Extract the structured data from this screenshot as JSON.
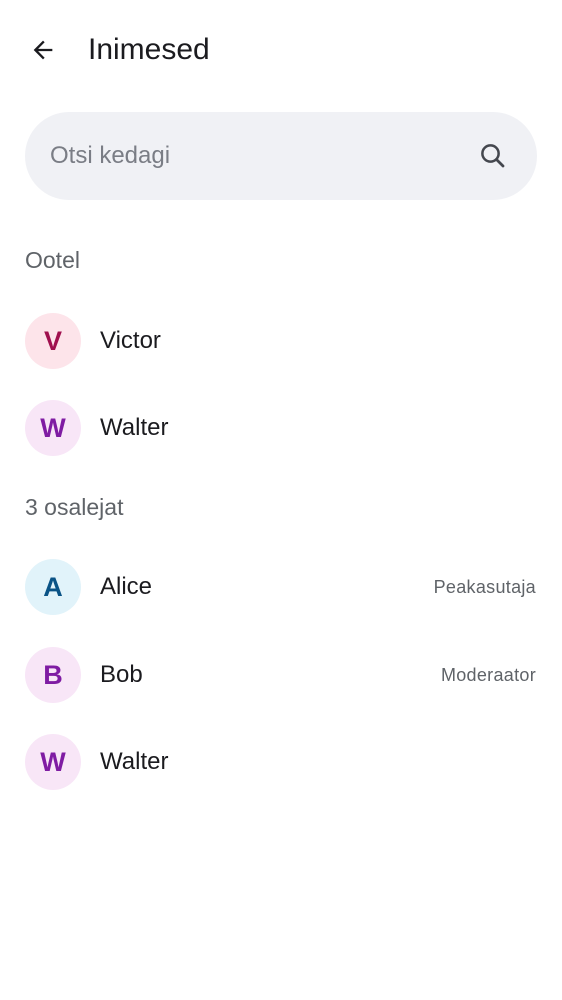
{
  "header": {
    "title": "Inimesed",
    "back_icon": "arrow-left-icon"
  },
  "search": {
    "placeholder": "Otsi kedagi",
    "value": "",
    "icon": "search-icon"
  },
  "pending": {
    "header": "Ootel",
    "members": [
      {
        "initial": "V",
        "name": "Victor",
        "role": "",
        "avatar_bg": "#fde4ea",
        "avatar_fg": "#a0104e"
      },
      {
        "initial": "W",
        "name": "Walter",
        "role": "",
        "avatar_bg": "#f8e6f7",
        "avatar_fg": "#7f1ca3"
      }
    ]
  },
  "joined": {
    "header": "3 osalejat",
    "members": [
      {
        "initial": "A",
        "name": "Alice",
        "role": "Peakasutaja",
        "avatar_bg": "#e1f3fa",
        "avatar_fg": "#0a5386"
      },
      {
        "initial": "B",
        "name": "Bob",
        "role": "Moderaator",
        "avatar_bg": "#f8e6f7",
        "avatar_fg": "#7f1ca3"
      },
      {
        "initial": "W",
        "name": "Walter",
        "role": "",
        "avatar_bg": "#f8e6f7",
        "avatar_fg": "#7f1ca3"
      }
    ]
  }
}
